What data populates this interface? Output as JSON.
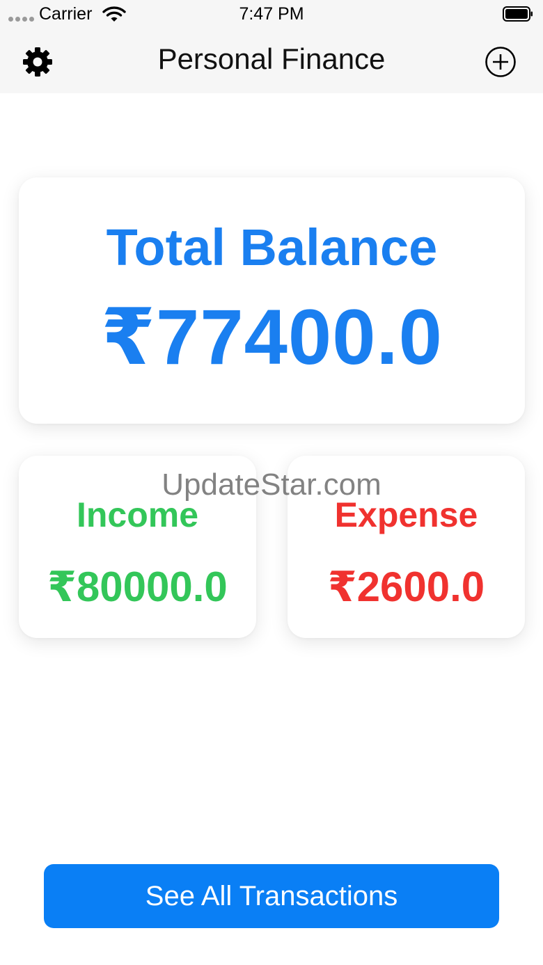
{
  "status_bar": {
    "carrier": "Carrier",
    "time": "7:47 PM",
    "icons": [
      "signal-dots-icon",
      "wifi-icon",
      "battery-icon"
    ]
  },
  "nav": {
    "title": "Personal Finance",
    "left_icon": "gear-icon",
    "right_icon": "plus-circle-icon"
  },
  "summary": {
    "total_label": "Total Balance",
    "total_value": "₹77400.0",
    "income_label": "Income",
    "income_value": "₹80000.0",
    "expense_label": "Expense",
    "expense_value": "₹2600.0"
  },
  "watermark": "UpdateStar.com",
  "actions": {
    "see_all_label": "See All Transactions"
  },
  "colors": {
    "accent": "#1a7ff0",
    "income": "#33c659",
    "expense": "#f0322f",
    "button": "#0a7ff5"
  }
}
